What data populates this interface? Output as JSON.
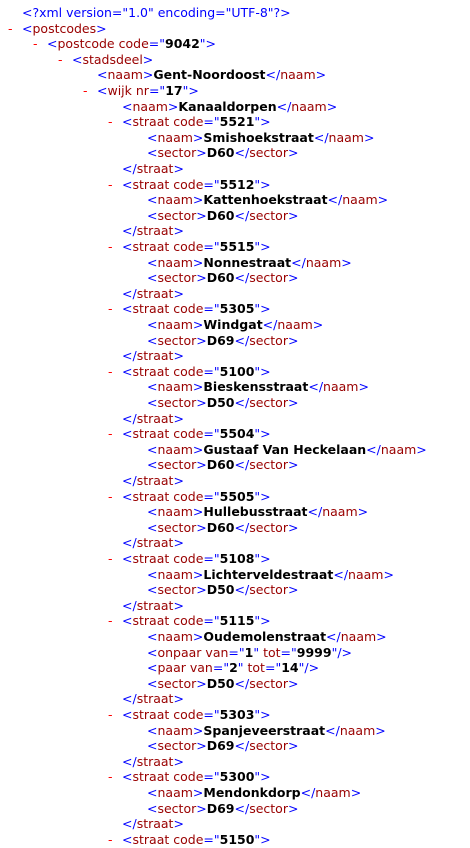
{
  "lines": [
    {
      "kind": "pi",
      "text": "<?xml version=\"1.0\" encoding=\"UTF-8\"?>"
    },
    {
      "kind": "open",
      "toggle": "-",
      "tag": "postcodes",
      "attrs": []
    },
    {
      "kind": "open",
      "toggle": "-",
      "tag": "postcode",
      "attrs": [
        {
          "name": "code",
          "value": "9042"
        }
      ]
    },
    {
      "kind": "open",
      "toggle": "-",
      "tag": "stadsdeel",
      "attrs": []
    },
    {
      "kind": "elem",
      "tag": "naam",
      "text": "Gent-Noordoost"
    },
    {
      "kind": "open",
      "toggle": "-",
      "tag": "wijk",
      "attrs": [
        {
          "name": "nr",
          "value": "17"
        }
      ]
    },
    {
      "kind": "elem",
      "tag": "naam",
      "text": "Kanaaldorpen"
    },
    {
      "kind": "open",
      "toggle": "-",
      "tag": "straat",
      "attrs": [
        {
          "name": "code",
          "value": "5521"
        }
      ]
    },
    {
      "kind": "elem",
      "tag": "naam",
      "text": "Smishoekstraat"
    },
    {
      "kind": "elem",
      "tag": "sector",
      "text": "D60"
    },
    {
      "kind": "close",
      "tag": "straat"
    },
    {
      "kind": "open",
      "toggle": "-",
      "tag": "straat",
      "attrs": [
        {
          "name": "code",
          "value": "5512"
        }
      ]
    },
    {
      "kind": "elem",
      "tag": "naam",
      "text": "Kattenhoekstraat"
    },
    {
      "kind": "elem",
      "tag": "sector",
      "text": "D60"
    },
    {
      "kind": "close",
      "tag": "straat"
    },
    {
      "kind": "open",
      "toggle": "-",
      "tag": "straat",
      "attrs": [
        {
          "name": "code",
          "value": "5515"
        }
      ]
    },
    {
      "kind": "elem",
      "tag": "naam",
      "text": "Nonnestraat"
    },
    {
      "kind": "elem",
      "tag": "sector",
      "text": "D60"
    },
    {
      "kind": "close",
      "tag": "straat"
    },
    {
      "kind": "open",
      "toggle": "-",
      "tag": "straat",
      "attrs": [
        {
          "name": "code",
          "value": "5305"
        }
      ]
    },
    {
      "kind": "elem",
      "tag": "naam",
      "text": "Windgat"
    },
    {
      "kind": "elem",
      "tag": "sector",
      "text": "D69"
    },
    {
      "kind": "close",
      "tag": "straat"
    },
    {
      "kind": "open",
      "toggle": "-",
      "tag": "straat",
      "attrs": [
        {
          "name": "code",
          "value": "5100"
        }
      ]
    },
    {
      "kind": "elem",
      "tag": "naam",
      "text": "Bieskensstraat"
    },
    {
      "kind": "elem",
      "tag": "sector",
      "text": "D50"
    },
    {
      "kind": "close",
      "tag": "straat"
    },
    {
      "kind": "open",
      "toggle": "-",
      "tag": "straat",
      "attrs": [
        {
          "name": "code",
          "value": "5504"
        }
      ]
    },
    {
      "kind": "elem",
      "tag": "naam",
      "text": "Gustaaf Van Heckelaan"
    },
    {
      "kind": "elem",
      "tag": "sector",
      "text": "D60"
    },
    {
      "kind": "close",
      "tag": "straat"
    },
    {
      "kind": "open",
      "toggle": "-",
      "tag": "straat",
      "attrs": [
        {
          "name": "code",
          "value": "5505"
        }
      ]
    },
    {
      "kind": "elem",
      "tag": "naam",
      "text": "Hullebusstraat"
    },
    {
      "kind": "elem",
      "tag": "sector",
      "text": "D60"
    },
    {
      "kind": "close",
      "tag": "straat"
    },
    {
      "kind": "open",
      "toggle": "-",
      "tag": "straat",
      "attrs": [
        {
          "name": "code",
          "value": "5108"
        }
      ]
    },
    {
      "kind": "elem",
      "tag": "naam",
      "text": "Lichterveldestraat"
    },
    {
      "kind": "elem",
      "tag": "sector",
      "text": "D50"
    },
    {
      "kind": "close",
      "tag": "straat"
    },
    {
      "kind": "open",
      "toggle": "-",
      "tag": "straat",
      "attrs": [
        {
          "name": "code",
          "value": "5115"
        }
      ]
    },
    {
      "kind": "elem",
      "tag": "naam",
      "text": "Oudemolenstraat"
    },
    {
      "kind": "empty",
      "tag": "onpaar",
      "attrs": [
        {
          "name": "van",
          "value": "1"
        },
        {
          "name": "tot",
          "value": "9999"
        }
      ]
    },
    {
      "kind": "empty",
      "tag": "paar",
      "attrs": [
        {
          "name": "van",
          "value": "2"
        },
        {
          "name": "tot",
          "value": "14"
        }
      ]
    },
    {
      "kind": "elem",
      "tag": "sector",
      "text": "D50"
    },
    {
      "kind": "close",
      "tag": "straat"
    },
    {
      "kind": "open",
      "toggle": "-",
      "tag": "straat",
      "attrs": [
        {
          "name": "code",
          "value": "5303"
        }
      ]
    },
    {
      "kind": "elem",
      "tag": "naam",
      "text": "Spanjeveerstraat"
    },
    {
      "kind": "elem",
      "tag": "sector",
      "text": "D69"
    },
    {
      "kind": "close",
      "tag": "straat"
    },
    {
      "kind": "open",
      "toggle": "-",
      "tag": "straat",
      "attrs": [
        {
          "name": "code",
          "value": "5300"
        }
      ]
    },
    {
      "kind": "elem",
      "tag": "naam",
      "text": "Mendonkdorp"
    },
    {
      "kind": "elem",
      "tag": "sector",
      "text": "D69"
    },
    {
      "kind": "close",
      "tag": "straat"
    },
    {
      "kind": "open",
      "toggle": "-",
      "tag": "straat",
      "attrs": [
        {
          "name": "code",
          "value": "5150"
        }
      ]
    }
  ]
}
